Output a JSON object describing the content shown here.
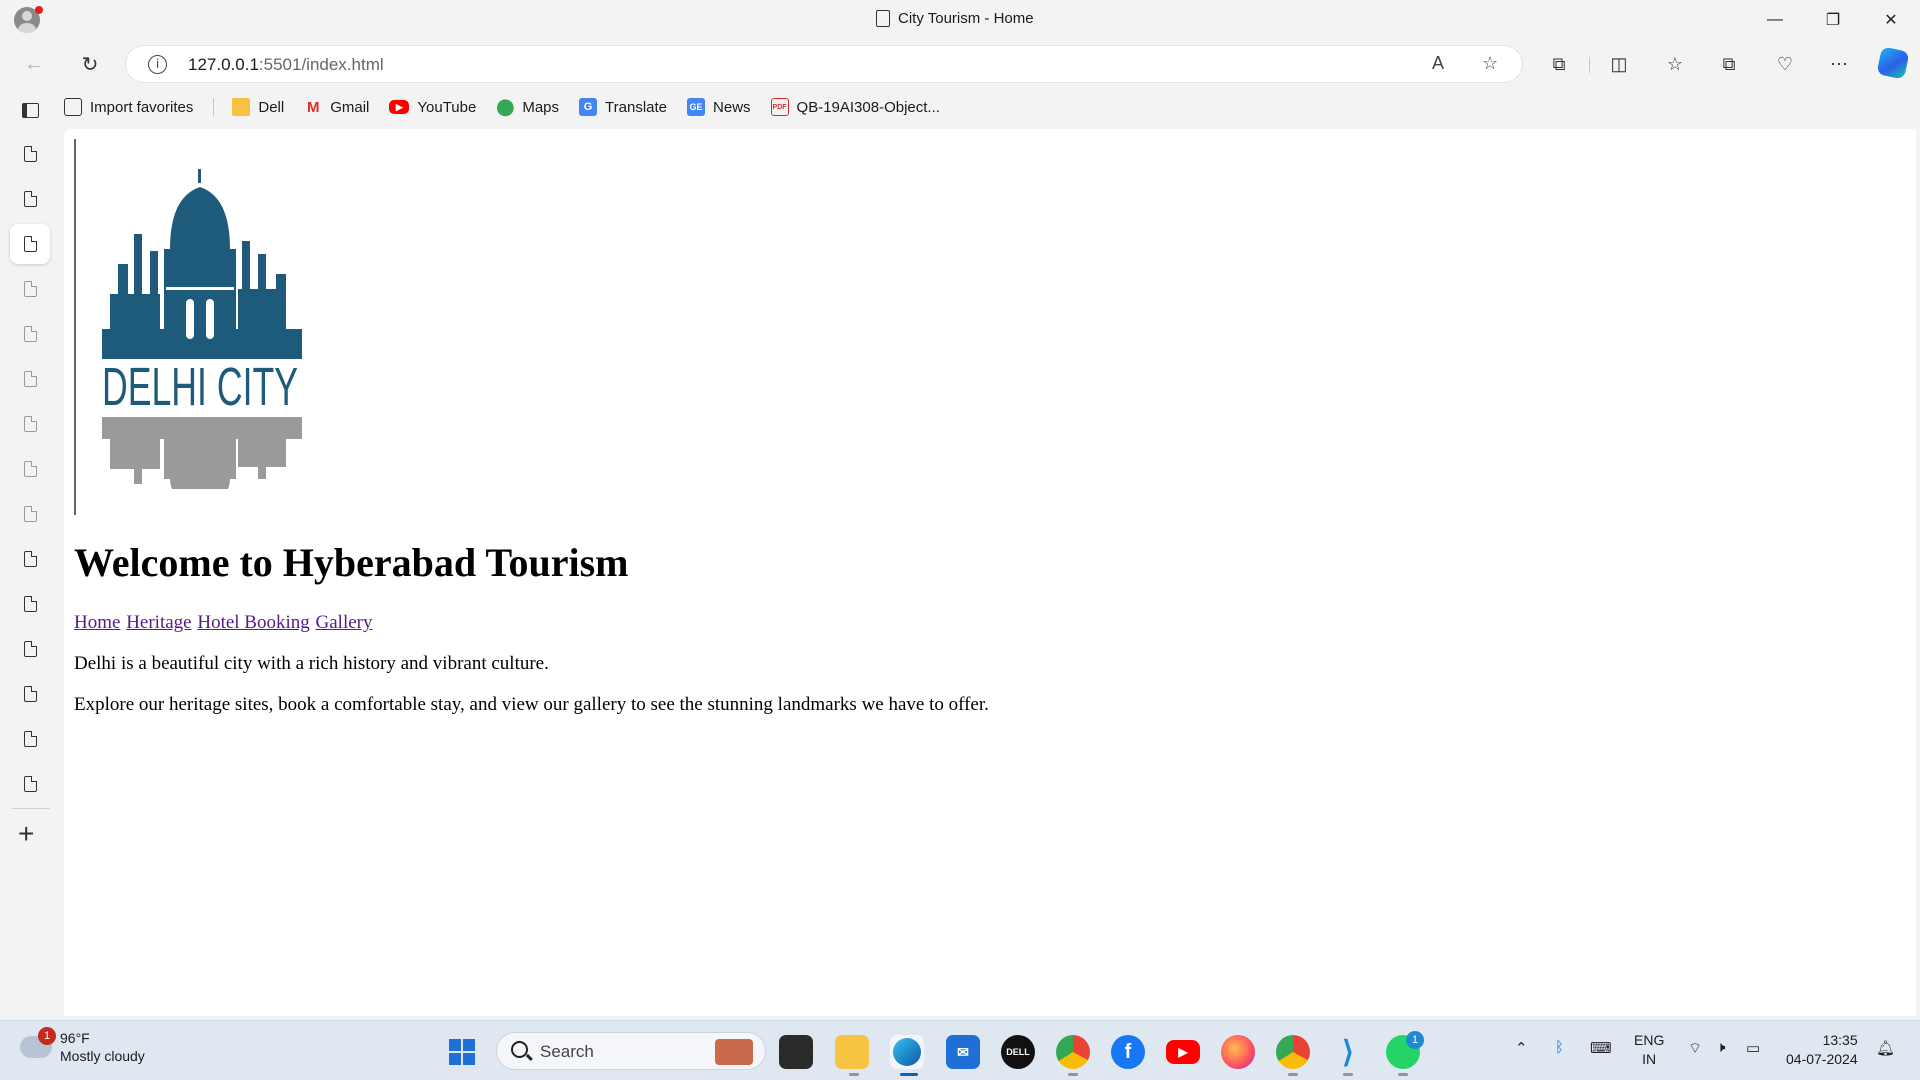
{
  "window": {
    "title": "City Tourism - Home",
    "minimize": "—",
    "restore": "❐",
    "close": "✕"
  },
  "address_bar": {
    "url_host": "127.0.0.1",
    "url_path": ":5501/index.html"
  },
  "favorites": [
    {
      "label": "Import favorites",
      "icon": "import-icon"
    },
    {
      "label": "Dell",
      "icon": "folder-icon"
    },
    {
      "label": "Gmail",
      "icon": "gmail-icon"
    },
    {
      "label": "YouTube",
      "icon": "youtube-icon"
    },
    {
      "label": "Maps",
      "icon": "maps-icon"
    },
    {
      "label": "Translate",
      "icon": "translate-icon"
    },
    {
      "label": "News",
      "icon": "news-icon"
    },
    {
      "label": "QB-19AI308-Object...",
      "icon": "pdf-icon"
    }
  ],
  "page": {
    "logo_text": "DELHI CITY",
    "heading": "Welcome to Hyberabad Tourism",
    "nav": [
      "Home",
      "Heritage",
      "Hotel Booking",
      "Gallery"
    ],
    "paragraphs": [
      "Delhi is a beautiful city with a rich history and vibrant culture.",
      "Explore our heritage sites, book a comfortable stay, and view our gallery to see the stunning landmarks we have to offer."
    ]
  },
  "taskbar": {
    "weather_temp": "96°F",
    "weather_desc": "Mostly cloudy",
    "weather_badge": "1",
    "search_placeholder": "Search",
    "whatsapp_badge": "1",
    "lang_line1": "ENG",
    "lang_line2": "IN",
    "time": "13:35",
    "date": "04-07-2024"
  },
  "colors": {
    "link_visited": "#551a8b",
    "logo_blue": "#1e5a7a",
    "logo_grey": "#9a9a9a"
  }
}
